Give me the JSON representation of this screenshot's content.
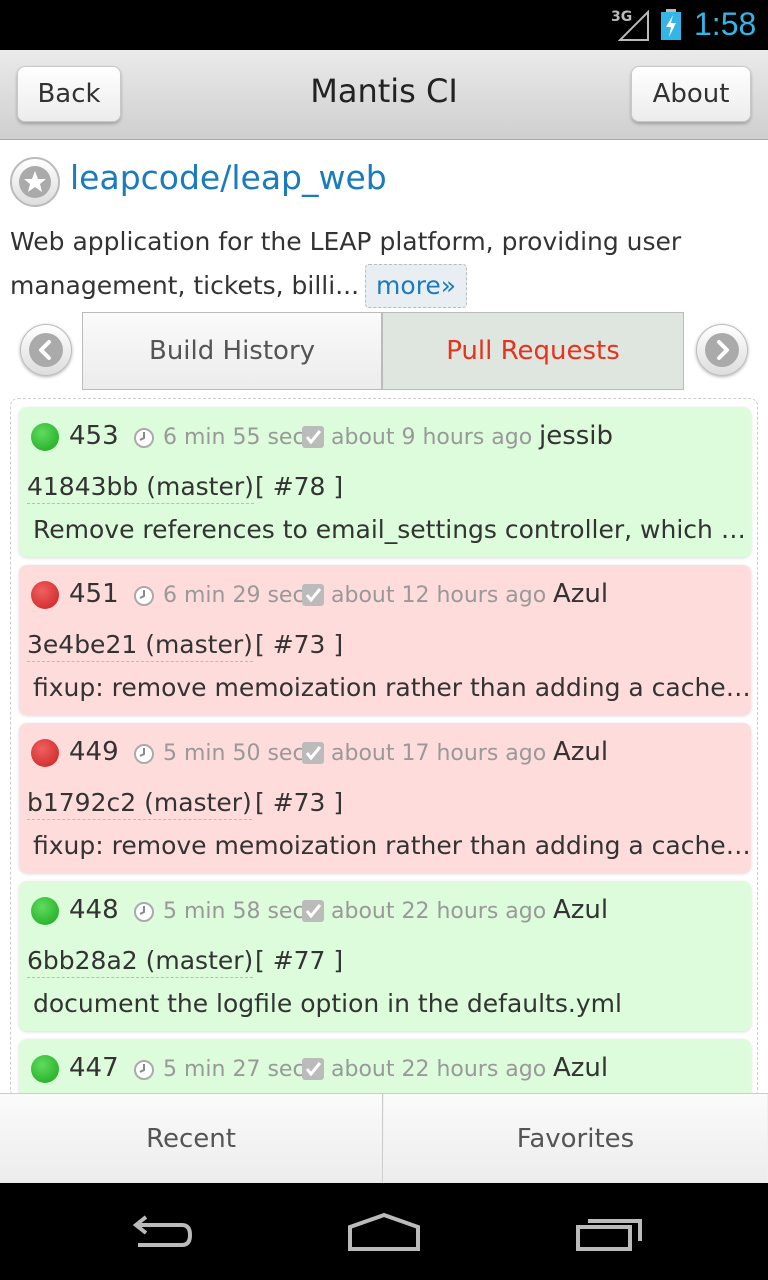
{
  "status_bar": {
    "network": "3G",
    "time": "1:58"
  },
  "header": {
    "back_label": "Back",
    "title": "Mantis CI",
    "about_label": "About"
  },
  "repo": {
    "name": "leapcode/leap_web",
    "description": "Web application for the LEAP platform, providing user management, tickets, billi...",
    "more_label": "more»"
  },
  "tabs": {
    "build_history": "Build History",
    "pull_requests": "Pull Requests"
  },
  "builds": [
    {
      "status": "passed",
      "number": "453",
      "duration": "6 min 55 sec,",
      "ago": "about 9 hours ago",
      "author": "jessib",
      "commit": "41843bb (master)",
      "pr": "[ #78 ]",
      "message": "Remove references to email_settings controller, which has been removed"
    },
    {
      "status": "failed",
      "number": "451",
      "duration": "6 min 29 sec,",
      "ago": "about 12 hours ago",
      "author": "Azul",
      "commit": "3e4be21 (master)",
      "pr": "[ #73 ]",
      "message": "fixup: remove memoization rather than adding a cache expiry"
    },
    {
      "status": "failed",
      "number": "449",
      "duration": "5 min 50 sec,",
      "ago": "about 17 hours ago",
      "author": "Azul",
      "commit": "b1792c2 (master)",
      "pr": "[ #73 ]",
      "message": "fixup: remove memoization rather than adding a cache expiry"
    },
    {
      "status": "passed",
      "number": "448",
      "duration": "5 min 58 sec,",
      "ago": "about 22 hours ago",
      "author": "Azul",
      "commit": "6bb28a2 (master)",
      "pr": "[ #77 ]",
      "message": "document the logfile option in the defaults.yml"
    },
    {
      "status": "passed",
      "number": "447",
      "duration": "5 min 27 sec,",
      "ago": "about 22 hours ago",
      "author": "Azul",
      "commit": "",
      "pr": "",
      "message": ""
    }
  ],
  "bottom_tabs": {
    "recent": "Recent",
    "favorites": "Favorites"
  },
  "colors": {
    "accent": "#1a7bbf",
    "active_tab": "#e8321c",
    "passed_bg": "#dcfcdc",
    "failed_bg": "#fedcdc",
    "clock": "#33b5e5"
  },
  "icons": [
    "star-icon",
    "chevron-left-icon",
    "chevron-right-icon",
    "clock-icon",
    "check-icon",
    "back-nav-icon",
    "home-nav-icon",
    "recents-nav-icon"
  ]
}
